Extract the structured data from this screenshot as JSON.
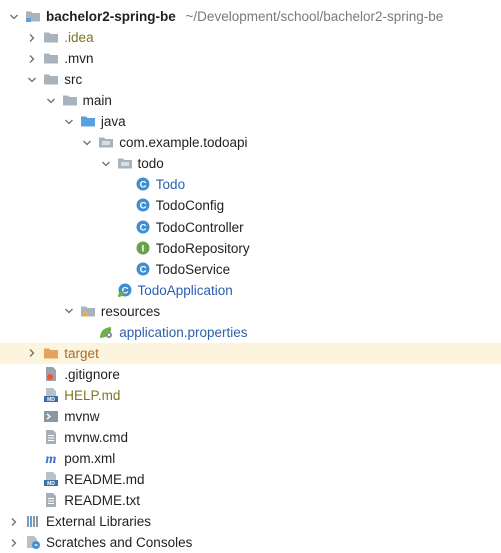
{
  "project": {
    "name": "bachelor2-spring-be",
    "path": "~/Development/school/bachelor2-spring-be"
  },
  "colors": {
    "folder": "#a9b3be",
    "source_folder": "#5aa0de",
    "resources_folder": "#a9b3be",
    "excluded_folder": "#e3a35b",
    "class_icon": "#3f8fd2",
    "interface_icon": "#68a24c",
    "highlight_row": "#fcf4dc",
    "text_default": "#1f1f1f",
    "text_blue": "#2a5fb0",
    "text_olive": "#7d7525",
    "text_orange": "#a46d2a"
  },
  "tree": [
    {
      "label": "bachelor2-spring-be",
      "path_label": "~/Development/school/bachelor2-spring-be",
      "depth": 0,
      "chevron": "down",
      "icon": "module-folder-icon",
      "color": "default",
      "bold": true
    },
    {
      "label": ".idea",
      "depth": 1,
      "chevron": "right",
      "icon": "folder-icon",
      "color": "olive"
    },
    {
      "label": ".mvn",
      "depth": 1,
      "chevron": "right",
      "icon": "folder-icon",
      "color": "default"
    },
    {
      "label": "src",
      "depth": 1,
      "chevron": "down",
      "icon": "folder-icon",
      "color": "default"
    },
    {
      "label": "main",
      "depth": 2,
      "chevron": "down",
      "icon": "folder-icon",
      "color": "default"
    },
    {
      "label": "java",
      "depth": 3,
      "chevron": "down",
      "icon": "source-folder-icon",
      "color": "default"
    },
    {
      "label": "com.example.todoapi",
      "depth": 4,
      "chevron": "down",
      "icon": "package-icon",
      "color": "default"
    },
    {
      "label": "todo",
      "depth": 5,
      "chevron": "down",
      "icon": "package-icon",
      "color": "default"
    },
    {
      "label": "Todo",
      "depth": 6,
      "chevron": "none",
      "icon": "class-icon",
      "color": "blue"
    },
    {
      "label": "TodoConfig",
      "depth": 6,
      "chevron": "none",
      "icon": "class-icon",
      "color": "default"
    },
    {
      "label": "TodoController",
      "depth": 6,
      "chevron": "none",
      "icon": "class-icon",
      "color": "default"
    },
    {
      "label": "TodoRepository",
      "depth": 6,
      "chevron": "none",
      "icon": "interface-icon",
      "color": "default"
    },
    {
      "label": "TodoService",
      "depth": 6,
      "chevron": "none",
      "icon": "class-icon",
      "color": "default"
    },
    {
      "label": "TodoApplication",
      "depth": 5,
      "chevron": "none",
      "icon": "spring-boot-class-icon",
      "color": "blue"
    },
    {
      "label": "resources",
      "depth": 3,
      "chevron": "down",
      "icon": "resources-folder-icon",
      "color": "default"
    },
    {
      "label": "application.properties",
      "depth": 4,
      "chevron": "none",
      "icon": "spring-properties-icon",
      "color": "blue"
    },
    {
      "label": "target",
      "depth": 1,
      "chevron": "right",
      "icon": "excluded-folder-icon",
      "color": "orange",
      "highlight": true
    },
    {
      "label": ".gitignore",
      "depth": 1,
      "chevron": "none",
      "icon": "gitignore-file-icon",
      "color": "default"
    },
    {
      "label": "HELP.md",
      "depth": 1,
      "chevron": "none",
      "icon": "markdown-file-icon",
      "color": "olive"
    },
    {
      "label": "mvnw",
      "depth": 1,
      "chevron": "none",
      "icon": "shell-file-icon",
      "color": "default"
    },
    {
      "label": "mvnw.cmd",
      "depth": 1,
      "chevron": "none",
      "icon": "text-file-icon",
      "color": "default"
    },
    {
      "label": "pom.xml",
      "depth": 1,
      "chevron": "none",
      "icon": "maven-pom-icon",
      "color": "default"
    },
    {
      "label": "README.md",
      "depth": 1,
      "chevron": "none",
      "icon": "markdown-file-icon",
      "color": "default"
    },
    {
      "label": "README.txt",
      "depth": 1,
      "chevron": "none",
      "icon": "text-file-icon",
      "color": "default"
    },
    {
      "label": "External Libraries",
      "depth": 0,
      "chevron": "right",
      "icon": "external-libraries-icon",
      "color": "default"
    },
    {
      "label": "Scratches and Consoles",
      "depth": 0,
      "chevron": "right",
      "icon": "scratches-icon",
      "color": "default"
    }
  ]
}
